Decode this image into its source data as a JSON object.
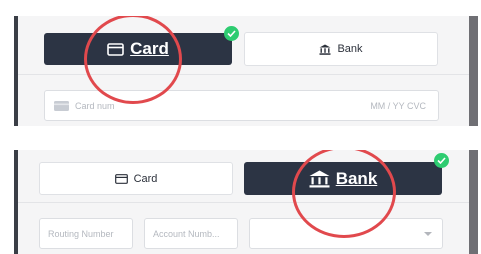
{
  "card_panel": {
    "tabs": {
      "card_label": "Card",
      "bank_label": "Bank"
    },
    "card_number_placeholder": "Card num",
    "expiry_cvc_placeholder": "MM / YY  CVC",
    "active_tab": "card"
  },
  "bank_panel": {
    "tabs": {
      "card_label": "Card",
      "bank_label": "Bank"
    },
    "routing_placeholder": "Routing Number",
    "account_placeholder": "Account Numb...",
    "select_value": "",
    "active_tab": "bank"
  },
  "colors": {
    "active_tab": "#2c3444",
    "highlight_circle": "#e1494d",
    "check_badge": "#2ecc71"
  },
  "icons": [
    "card-icon",
    "bank-icon",
    "checkmark-icon",
    "chevron-down-icon"
  ]
}
